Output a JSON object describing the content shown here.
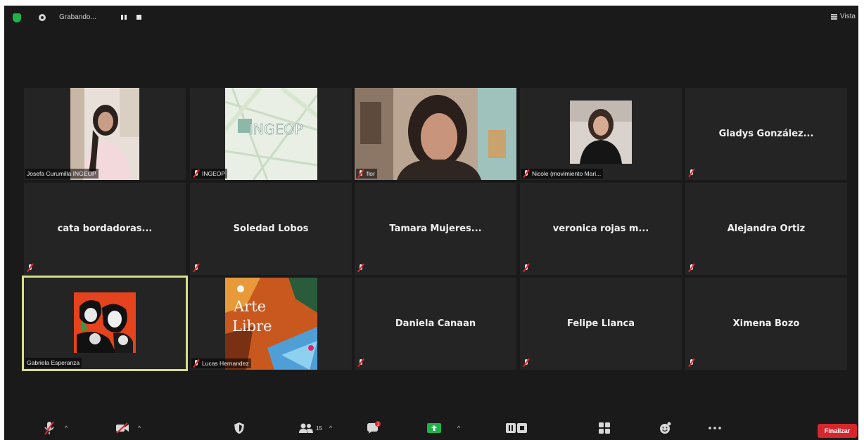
{
  "topbar": {
    "recording_label": "Grabando...",
    "view_label": "Vista",
    "icons": [
      "shield-icon",
      "record-icon",
      "pause-icon",
      "stop-icon",
      "grid-view-icon"
    ]
  },
  "tiles": {
    "josefa": {
      "label": "Josefa Curumilla INGEOP",
      "muted": false
    },
    "ingeop": {
      "label": "INGEOP",
      "muted": true,
      "logo_text": "INGEOP"
    },
    "flor": {
      "label": "flor",
      "muted": true
    },
    "nicole": {
      "label": "Nicole (movimiento Mari...",
      "muted": true
    },
    "gladys": {
      "name": "Gladys González...",
      "muted": true
    },
    "cata": {
      "name": "cata bordadoras...",
      "muted": true
    },
    "soledad": {
      "name": "Soledad Lobos",
      "muted": true
    },
    "tamara": {
      "name": "Tamara Mujeres...",
      "muted": true
    },
    "veronica": {
      "name": "veronica rojas m...",
      "muted": true
    },
    "alejandra": {
      "name": "Alejandra Ortiz",
      "muted": true
    },
    "gabriela": {
      "label": "Gabriela Esperanza",
      "muted": false,
      "active_speaker": true
    },
    "lucas": {
      "label": "Lucas Hernandez",
      "muted": true,
      "art_text_1": "Arte",
      "art_text_2": "Libre"
    },
    "daniela": {
      "name": "Daniela Canaan",
      "muted": true
    },
    "felipe": {
      "name": "Felipe Llanca",
      "muted": true
    },
    "ximena": {
      "name": "Ximena Bozo",
      "muted": true
    }
  },
  "toolbar": {
    "participants_count": "15",
    "chat_badge": "1",
    "end_label": "Finalizar",
    "icons": [
      "mic-muted-icon",
      "video-off-icon",
      "security-icon",
      "participants-icon",
      "chat-icon",
      "share-screen-icon",
      "record-pause-icon",
      "apps-icon",
      "reactions-icon",
      "more-icon"
    ]
  },
  "colors": {
    "background": "#1a1a1a",
    "tile": "#242424",
    "active_speaker_border": "#d8de8a",
    "mute_red": "#e0242b",
    "share_green": "#1fb24a",
    "end_button": "#d6262e",
    "security_shield": "#1fb24a"
  }
}
